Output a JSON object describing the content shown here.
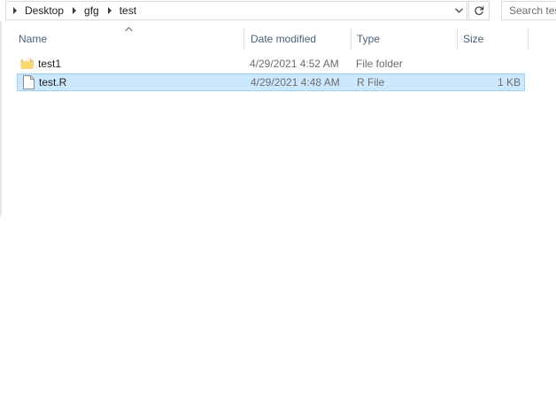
{
  "address_bar": {
    "breadcrumbs": [
      {
        "label": "Desktop"
      },
      {
        "label": "gfg"
      },
      {
        "label": "test"
      }
    ],
    "dropdown_icon": "chevron-down-icon",
    "refresh_icon": "refresh-icon"
  },
  "search": {
    "placeholder": "Search test"
  },
  "columns": {
    "name": "Name",
    "date_modified": "Date modified",
    "type": "Type",
    "size": "Size",
    "sorted_by": "name"
  },
  "files": [
    {
      "name": "test1",
      "date_modified": "4/29/2021 4:52 AM",
      "type": "File folder",
      "size": "",
      "icon": "folder-icon",
      "selected": false
    },
    {
      "name": "test.R",
      "date_modified": "4/29/2021 4:48 AM",
      "type": "R File",
      "size": "1 KB",
      "icon": "file-icon",
      "selected": true
    }
  ],
  "colors": {
    "selection_bg": "#cce8ff",
    "selection_border": "#99d1ff",
    "header_text": "#4c607a",
    "secondary_text": "#6d6d6d"
  }
}
